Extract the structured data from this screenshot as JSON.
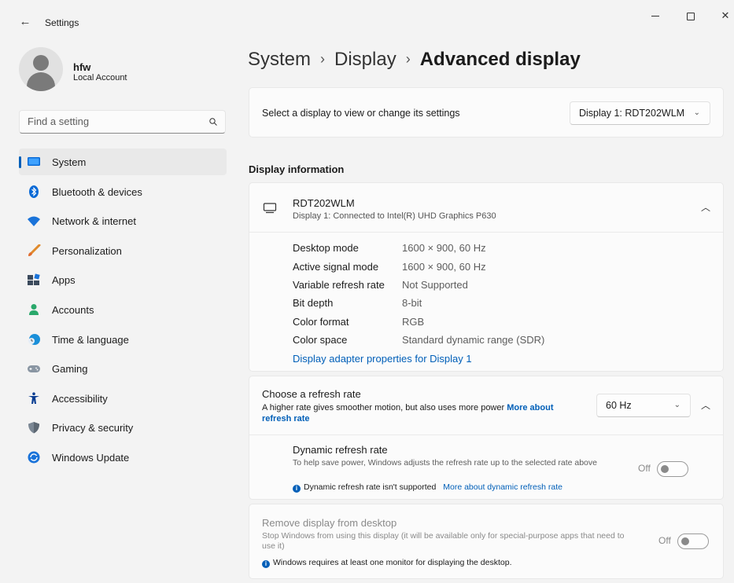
{
  "window": {
    "title": "Settings",
    "back": "←",
    "close": "✕"
  },
  "account": {
    "name": "hfw",
    "type": "Local Account"
  },
  "search": {
    "placeholder": "Find a setting"
  },
  "nav": {
    "items": [
      {
        "label": "System",
        "active": true,
        "icon": "system-icon"
      },
      {
        "label": "Bluetooth & devices",
        "icon": "bluetooth-icon"
      },
      {
        "label": "Network & internet",
        "icon": "wifi-icon"
      },
      {
        "label": "Personalization",
        "icon": "brush-icon"
      },
      {
        "label": "Apps",
        "icon": "apps-icon"
      },
      {
        "label": "Accounts",
        "icon": "person-icon"
      },
      {
        "label": "Time & language",
        "icon": "clock-globe-icon"
      },
      {
        "label": "Gaming",
        "icon": "gamepad-icon"
      },
      {
        "label": "Accessibility",
        "icon": "accessibility-icon"
      },
      {
        "label": "Privacy & security",
        "icon": "shield-icon"
      },
      {
        "label": "Windows Update",
        "icon": "update-icon"
      }
    ]
  },
  "breadcrumb": {
    "part1": "System",
    "part2": "Display",
    "current": "Advanced display",
    "sep": "›"
  },
  "select_display": {
    "label": "Select a display to view or change its settings",
    "value": "Display 1: RDT202WLM"
  },
  "display_info": {
    "heading": "Display information",
    "name": "RDT202WLM",
    "subtitle": "Display 1: Connected to Intel(R) UHD Graphics P630",
    "rows": [
      {
        "key": "Desktop mode",
        "value": "1600 × 900, 60 Hz"
      },
      {
        "key": "Active signal mode",
        "value": "1600 × 900, 60 Hz"
      },
      {
        "key": "Variable refresh rate",
        "value": "Not Supported"
      },
      {
        "key": "Bit depth",
        "value": "8-bit"
      },
      {
        "key": "Color format",
        "value": "RGB"
      },
      {
        "key": "Color space",
        "value": "Standard dynamic range (SDR)"
      }
    ],
    "adapter_link": "Display adapter properties for Display 1"
  },
  "refresh": {
    "title": "Choose a refresh rate",
    "desc": "A higher rate gives smoother motion, but also uses more power",
    "more_link": "More about refresh rate",
    "value": "60 Hz",
    "dynamic_title": "Dynamic refresh rate",
    "dynamic_desc": "To help save power, Windows adjusts the refresh rate up to the selected rate above",
    "dynamic_note": "Dynamic refresh rate isn't supported",
    "dynamic_link": "More about dynamic refresh rate",
    "dynamic_state": "Off"
  },
  "remove": {
    "title": "Remove display from desktop",
    "desc": "Stop Windows from using this display (it will be available only for special-purpose apps that need to use it)",
    "note": "Windows requires at least one monitor for displaying the desktop.",
    "state": "Off"
  },
  "colors": {
    "accent": "#005fb8",
    "background": "#f3f3f3",
    "card": "#fbfbfb"
  }
}
